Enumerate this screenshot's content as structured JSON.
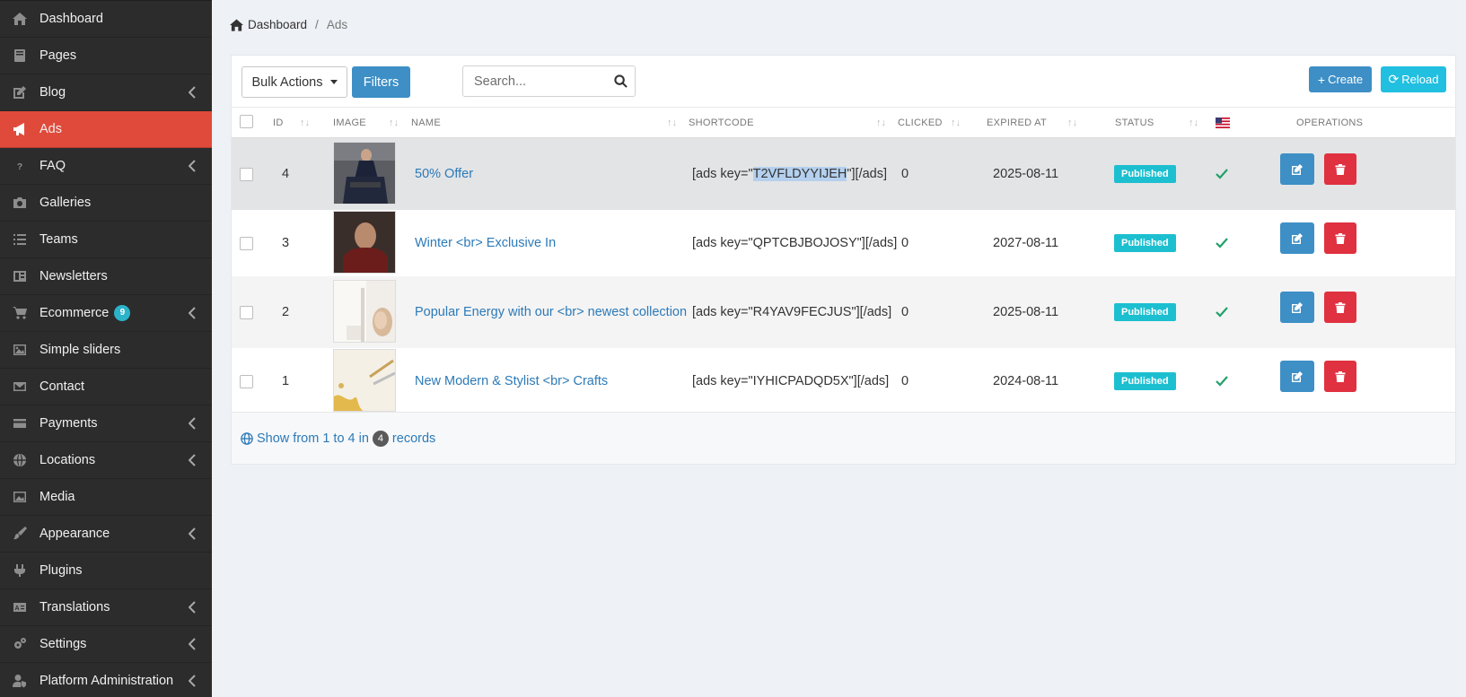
{
  "sidebar": {
    "items": [
      {
        "label": "Dashboard",
        "icon": "home-icon",
        "arrow": false,
        "active": false
      },
      {
        "label": "Pages",
        "icon": "book-icon",
        "arrow": false,
        "active": false
      },
      {
        "label": "Blog",
        "icon": "edit-icon",
        "arrow": true,
        "active": false
      },
      {
        "label": "Ads",
        "icon": "bullhorn-icon",
        "arrow": false,
        "active": true
      },
      {
        "label": "FAQ",
        "icon": "question-circle-icon",
        "arrow": true,
        "active": false
      },
      {
        "label": "Galleries",
        "icon": "camera-icon",
        "arrow": false,
        "active": false
      },
      {
        "label": "Teams",
        "icon": "list-icon",
        "arrow": false,
        "active": false
      },
      {
        "label": "Newsletters",
        "icon": "newspaper-icon",
        "arrow": false,
        "active": false
      },
      {
        "label": "Ecommerce",
        "icon": "shopping-cart-icon",
        "arrow": true,
        "active": false,
        "badge": "9"
      },
      {
        "label": "Simple sliders",
        "icon": "image-icon",
        "arrow": false,
        "active": false
      },
      {
        "label": "Contact",
        "icon": "envelope-icon",
        "arrow": false,
        "active": false
      },
      {
        "label": "Payments",
        "icon": "credit-card-icon",
        "arrow": true,
        "active": false
      },
      {
        "label": "Locations",
        "icon": "globe-icon",
        "arrow": true,
        "active": false
      },
      {
        "label": "Media",
        "icon": "images-icon",
        "arrow": false,
        "active": false
      },
      {
        "label": "Appearance",
        "icon": "paint-brush-icon",
        "arrow": true,
        "active": false
      },
      {
        "label": "Plugins",
        "icon": "plug-icon",
        "arrow": false,
        "active": false
      },
      {
        "label": "Translations",
        "icon": "language-icon",
        "arrow": true,
        "active": false
      },
      {
        "label": "Settings",
        "icon": "cogs-icon",
        "arrow": true,
        "active": false
      },
      {
        "label": "Platform Administration",
        "icon": "user-shield-icon",
        "arrow": true,
        "active": false
      }
    ]
  },
  "breadcrumb": {
    "home": "Dashboard",
    "separator": "/",
    "current": "Ads"
  },
  "toolbar": {
    "bulk_label": "Bulk Actions",
    "filters_label": "Filters",
    "search_placeholder": "Search...",
    "create_label": "Create",
    "reload_label": "Reload"
  },
  "table": {
    "headers": {
      "id": "ID",
      "image": "IMAGE",
      "name": "NAME",
      "shortcode": "SHORTCODE",
      "clicked": "CLICKED",
      "expired": "EXPIRED AT",
      "status": "STATUS",
      "operations": "OPERATIONS"
    },
    "rows": [
      {
        "id": "4",
        "name": "50% Offer",
        "shortcode_prefix": "[ads key=\"",
        "shortcode_key": "T2VFLDYYIJEH",
        "shortcode_suffix": "\"][/ads]",
        "clicked": "0",
        "expired": "2025-08-11",
        "status": "Published",
        "image": "man-in-suit"
      },
      {
        "id": "3",
        "name": "Winter <br> Exclusive In",
        "shortcode_prefix": "[ads key=\"",
        "shortcode_key": "QPTCBJBOJOSY",
        "shortcode_suffix": "\"][/ads]",
        "clicked": "0",
        "expired": "2027-08-11",
        "status": "Published",
        "image": "man-in-sweater"
      },
      {
        "id": "2",
        "name": "Popular Energy with our <br> newest collection",
        "shortcode_prefix": "[ads key=\"",
        "shortcode_key": "R4YAV9FECJUS",
        "shortcode_suffix": "\"][/ads]",
        "clicked": "0",
        "expired": "2025-08-11",
        "status": "Published",
        "image": "white-ceramics"
      },
      {
        "id": "1",
        "name": "New Modern & Stylist <br> Crafts",
        "shortcode_prefix": "[ads key=\"",
        "shortcode_key": "IYHICPADQD5X",
        "shortcode_suffix": "\"][/ads]",
        "clicked": "0",
        "expired": "2024-08-11",
        "status": "Published",
        "image": "gold-crafts"
      }
    ]
  },
  "footer": {
    "prefix": "Show from 1 to 4 in",
    "count": "4",
    "suffix": "records"
  },
  "colors": {
    "sidebar_bg": "#2c2c2c",
    "active": "#e04a3a",
    "primary": "#3d8fc6",
    "info": "#21bfe0",
    "danger": "#e03140",
    "published": "#1cbfd0",
    "link": "#2c7ab8"
  }
}
